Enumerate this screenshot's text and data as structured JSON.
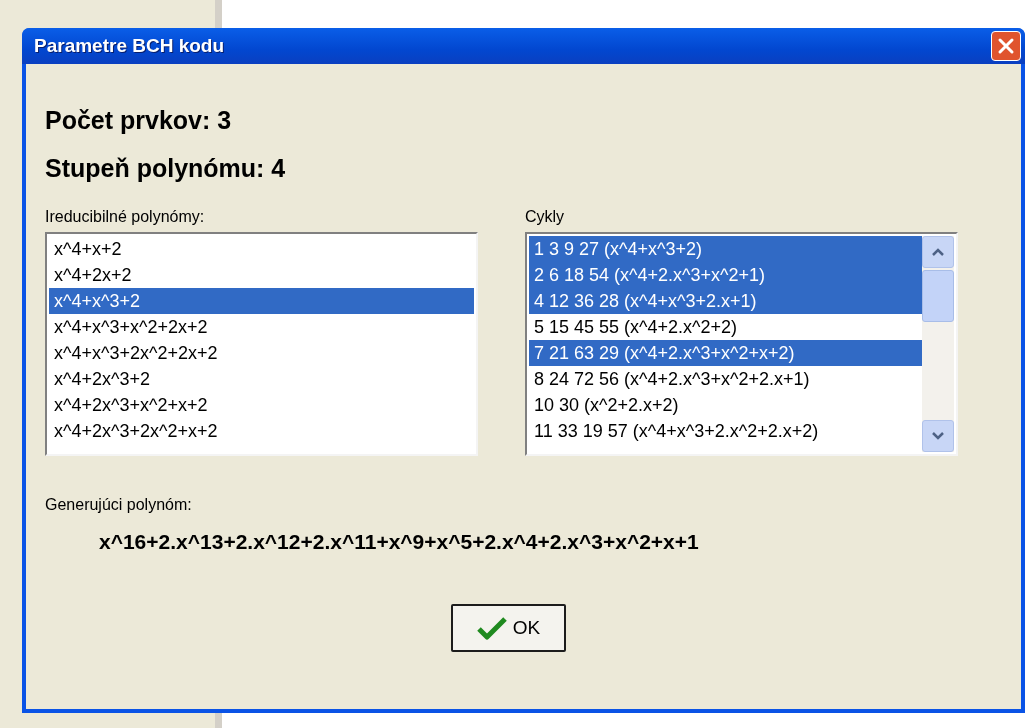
{
  "window": {
    "title": "Parametre BCH kodu"
  },
  "summary": [
    {
      "label": "Počet prvkov: 3"
    },
    {
      "label": "Stupeň polynómu: 4"
    }
  ],
  "irreducible": {
    "label": "Ireducibilné polynómy:",
    "items": [
      {
        "text": "x^4+x+2",
        "selected": false
      },
      {
        "text": "x^4+2x+2",
        "selected": false
      },
      {
        "text": "x^4+x^3+2",
        "selected": true
      },
      {
        "text": "x^4+x^3+x^2+2x+2",
        "selected": false
      },
      {
        "text": "x^4+x^3+2x^2+2x+2",
        "selected": false
      },
      {
        "text": "x^4+2x^3+2",
        "selected": false
      },
      {
        "text": "x^4+2x^3+x^2+x+2",
        "selected": false
      },
      {
        "text": "x^4+2x^3+2x^2+x+2",
        "selected": false
      }
    ]
  },
  "cycles": {
    "label": "Cykly",
    "items": [
      {
        "text": "1 3 9 27 (x^4+x^3+2)",
        "selected": true
      },
      {
        "text": "2 6 18 54 (x^4+2.x^3+x^2+1)",
        "selected": true
      },
      {
        "text": "4 12 36 28 (x^4+x^3+2.x+1)",
        "selected": true
      },
      {
        "text": "5 15 45 55 (x^4+2.x^2+2)",
        "selected": false
      },
      {
        "text": "7 21 63 29 (x^4+2.x^3+x^2+x+2)",
        "selected": true
      },
      {
        "text": "8 24 72 56 (x^4+2.x^3+x^2+2.x+1)",
        "selected": false
      },
      {
        "text": "10 30 (x^2+2.x+2)",
        "selected": false
      },
      {
        "text": "11 33 19 57 (x^4+x^3+2.x^2+2.x+2)",
        "selected": false
      }
    ]
  },
  "generator": {
    "label": "Generujúci polynóm:",
    "value": "x^16+2.x^13+2.x^12+2.x^11+x^9+x^5+2.x^4+2.x^3+x^2+x+1"
  },
  "buttons": [
    {
      "label": "OK"
    }
  ]
}
